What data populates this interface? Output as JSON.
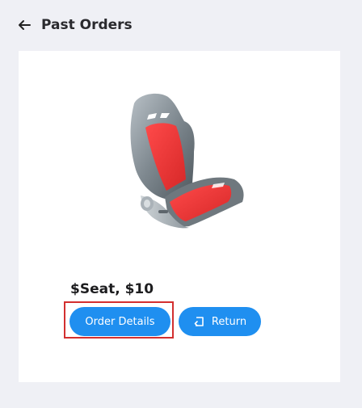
{
  "header": {
    "back_icon": "arrow-left-icon",
    "title": "Past Orders"
  },
  "order": {
    "image_icon": "car-seat-image",
    "title": "$Seat, $10",
    "details_label": "Order Details",
    "return_label": "Return",
    "return_icon": "return-icon"
  },
  "colors": {
    "background": "#eff0f5",
    "card": "#ffffff",
    "primary_button": "#1f8ff0",
    "highlight": "#d32f2f",
    "seat_red": "#f03c3c",
    "seat_grey": "#8a9399"
  }
}
